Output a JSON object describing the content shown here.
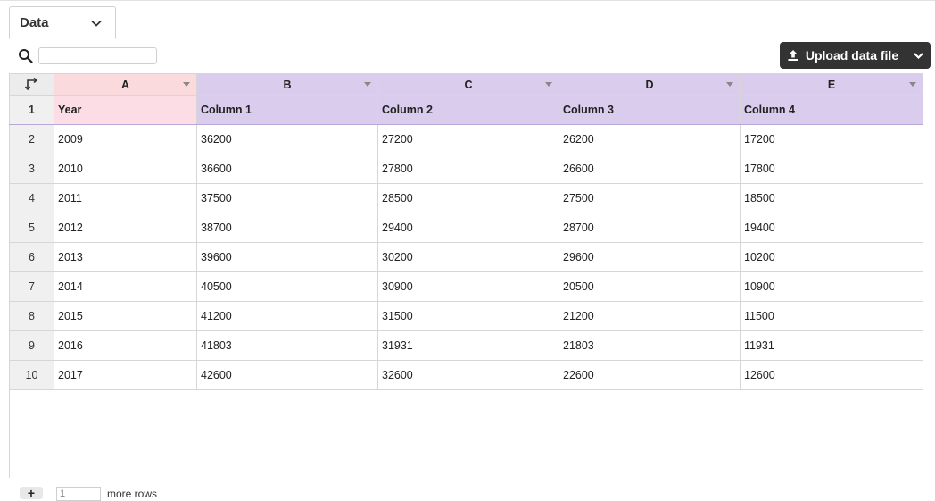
{
  "tab": {
    "label": "Data",
    "icon": "chevron-down-icon"
  },
  "search": {
    "value": "",
    "placeholder": ""
  },
  "upload": {
    "label": "Upload data file"
  },
  "columns": [
    "A",
    "B",
    "C",
    "D",
    "E"
  ],
  "header_row": {
    "num": "1",
    "cells": [
      "Year",
      "Column 1",
      "Column 2",
      "Column 3",
      "Column 4"
    ]
  },
  "rows": [
    {
      "num": "2",
      "cells": [
        "2009",
        "36200",
        "27200",
        "26200",
        "17200"
      ]
    },
    {
      "num": "3",
      "cells": [
        "2010",
        "36600",
        "27800",
        "26600",
        "17800"
      ]
    },
    {
      "num": "4",
      "cells": [
        "2011",
        "37500",
        "28500",
        "27500",
        "18500"
      ]
    },
    {
      "num": "5",
      "cells": [
        "2012",
        "38700",
        "29400",
        "28700",
        "19400"
      ]
    },
    {
      "num": "6",
      "cells": [
        "2013",
        "39600",
        "30200",
        "29600",
        "10200"
      ]
    },
    {
      "num": "7",
      "cells": [
        "2014",
        "40500",
        "30900",
        "20500",
        "10900"
      ]
    },
    {
      "num": "8",
      "cells": [
        "2015",
        "41200",
        "31500",
        "21200",
        "11500"
      ]
    },
    {
      "num": "9",
      "cells": [
        "2016",
        "41803",
        "31931",
        "21803",
        "11931"
      ]
    },
    {
      "num": "10",
      "cells": [
        "2017",
        "42600",
        "32600",
        "22600",
        "12600"
      ]
    }
  ],
  "footer": {
    "add_label": "+",
    "rows_value": "1",
    "more_rows_label": "more rows"
  },
  "colors": {
    "label_column": "#fadadd",
    "value_columns": "#d9ccec",
    "button": "#333333"
  }
}
